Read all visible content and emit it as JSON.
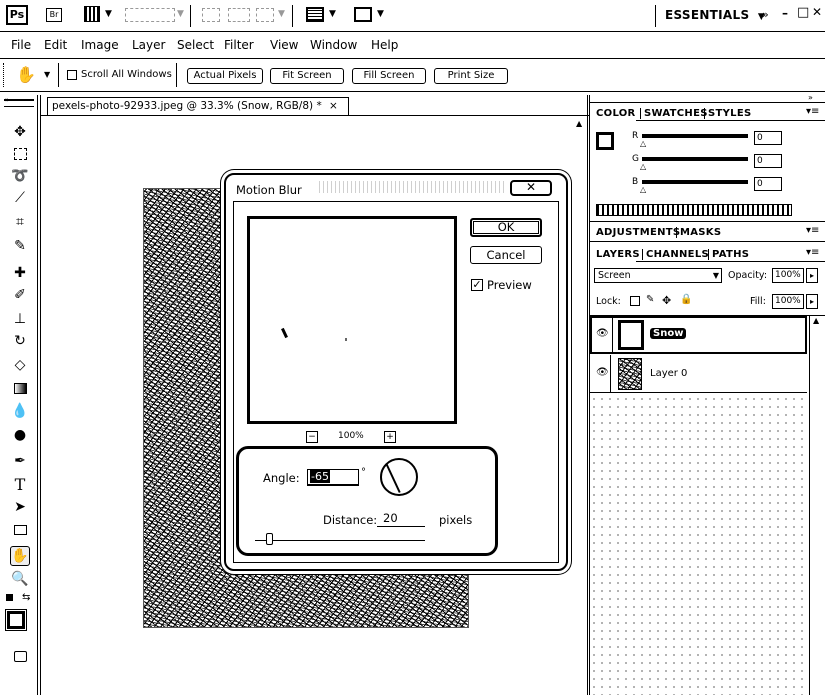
{
  "app": {
    "logo": "Ps",
    "workspace": "ESSENTIALS",
    "title_controls": [
      "–",
      "□",
      "✕"
    ]
  },
  "menu": [
    "File",
    "Edit",
    "Image",
    "Layer",
    "Select",
    "Filter",
    "View",
    "Window",
    "Help"
  ],
  "options_bar": {
    "scroll_all_label": "Scroll All Windows",
    "buttons": [
      "Actual Pixels",
      "Fit Screen",
      "Fill Screen",
      "Print Size"
    ]
  },
  "document": {
    "tab_title": "pexels-photo-92933.jpeg @ 33.3% (Snow, RGB/8) *",
    "close": "×"
  },
  "dialog": {
    "title": "Motion Blur",
    "ok_label": "OK",
    "cancel_label": "Cancel",
    "preview_label": "Preview",
    "preview_checked": true,
    "zoom_out": "−",
    "zoom_in": "+",
    "zoom_level": "100%",
    "angle_label": "Angle:",
    "angle_value": "-65",
    "degree_symbol": "°",
    "distance_label": "Distance:",
    "distance_value": "20",
    "distance_unit": "pixels"
  },
  "color_panel": {
    "tabs": [
      "COLOR",
      "SWATCHES",
      "STYLES"
    ],
    "channels": [
      {
        "label": "R",
        "value": "0"
      },
      {
        "label": "G",
        "value": "0"
      },
      {
        "label": "B",
        "value": "0"
      }
    ]
  },
  "adjustments_panel": {
    "tabs": [
      "ADJUSTMENTS",
      "MASKS"
    ]
  },
  "layers_panel": {
    "tabs": [
      "LAYERS",
      "CHANNELS",
      "PATHS"
    ],
    "blend_mode": "Screen",
    "opacity_label": "Opacity:",
    "opacity_value": "100%",
    "lock_label": "Lock:",
    "fill_label": "Fill:",
    "fill_value": "100%",
    "layers": [
      {
        "name": "Snow",
        "selected": true
      },
      {
        "name": "Layer 0",
        "selected": false
      }
    ]
  },
  "colors": {
    "foreground": "#000000",
    "background": "#ffffff"
  }
}
